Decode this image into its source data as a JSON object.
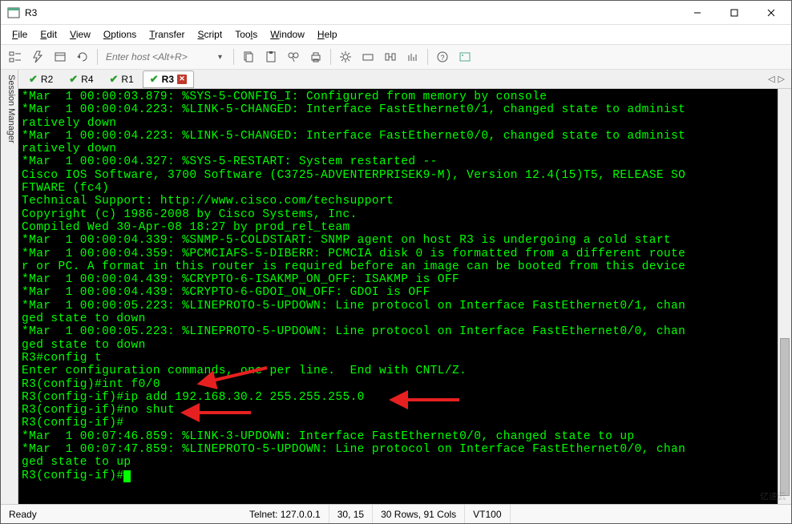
{
  "window": {
    "title": "R3",
    "minimize": "–",
    "maximize": "□",
    "close": "✕"
  },
  "menu": {
    "file": "File",
    "edit": "Edit",
    "view": "View",
    "options": "Options",
    "transfer": "Transfer",
    "script": "Script",
    "tools": "Tools",
    "window": "Window",
    "help": "Help"
  },
  "toolbar": {
    "host_placeholder": "Enter host <Alt+R>"
  },
  "sidebar": {
    "label": "Session Manager"
  },
  "tabs": [
    {
      "label": "R2",
      "active": false
    },
    {
      "label": "R4",
      "active": false
    },
    {
      "label": "R1",
      "active": false
    },
    {
      "label": "R3",
      "active": true
    }
  ],
  "terminal_lines": [
    "*Mar  1 00:00:03.879: %SYS-5-CONFIG_I: Configured from memory by console",
    "*Mar  1 00:00:04.223: %LINK-5-CHANGED: Interface FastEthernet0/1, changed state to administ",
    "ratively down",
    "*Mar  1 00:00:04.223: %LINK-5-CHANGED: Interface FastEthernet0/0, changed state to administ",
    "ratively down",
    "*Mar  1 00:00:04.327: %SYS-5-RESTART: System restarted --",
    "Cisco IOS Software, 3700 Software (C3725-ADVENTERPRISEK9-M), Version 12.4(15)T5, RELEASE SO",
    "FTWARE (fc4)",
    "Technical Support: http://www.cisco.com/techsupport",
    "Copyright (c) 1986-2008 by Cisco Systems, Inc.",
    "Compiled Wed 30-Apr-08 18:27 by prod_rel_team",
    "*Mar  1 00:00:04.339: %SNMP-5-COLDSTART: SNMP agent on host R3 is undergoing a cold start",
    "*Mar  1 00:00:04.359: %PCMCIAFS-5-DIBERR: PCMCIA disk 0 is formatted from a different route",
    "r or PC. A format in this router is required before an image can be booted from this device",
    "*Mar  1 00:00:04.439: %CRYPTO-6-ISAKMP_ON_OFF: ISAKMP is OFF",
    "*Mar  1 00:00:04.439: %CRYPTO-6-GDOI_ON_OFF: GDOI is OFF",
    "*Mar  1 00:00:05.223: %LINEPROTO-5-UPDOWN: Line protocol on Interface FastEthernet0/1, chan",
    "ged state to down",
    "*Mar  1 00:00:05.223: %LINEPROTO-5-UPDOWN: Line protocol on Interface FastEthernet0/0, chan",
    "ged state to down",
    "R3#config t",
    "Enter configuration commands, one per line.  End with CNTL/Z.",
    "R3(config)#int f0/0",
    "R3(config-if)#ip add 192.168.30.2 255.255.255.0",
    "R3(config-if)#no shut",
    "R3(config-if)#",
    "*Mar  1 00:07:46.859: %LINK-3-UPDOWN: Interface FastEthernet0/0, changed state to up",
    "*Mar  1 00:07:47.859: %LINEPROTO-5-UPDOWN: Line protocol on Interface FastEthernet0/0, chan",
    "ged state to up",
    "R3(config-if)#"
  ],
  "status": {
    "ready": "Ready",
    "conn": "Telnet: 127.0.0.1",
    "pos": "30,  15",
    "size": "30 Rows, 91 Cols",
    "term": "VT100"
  },
  "watermark": "亿速云"
}
